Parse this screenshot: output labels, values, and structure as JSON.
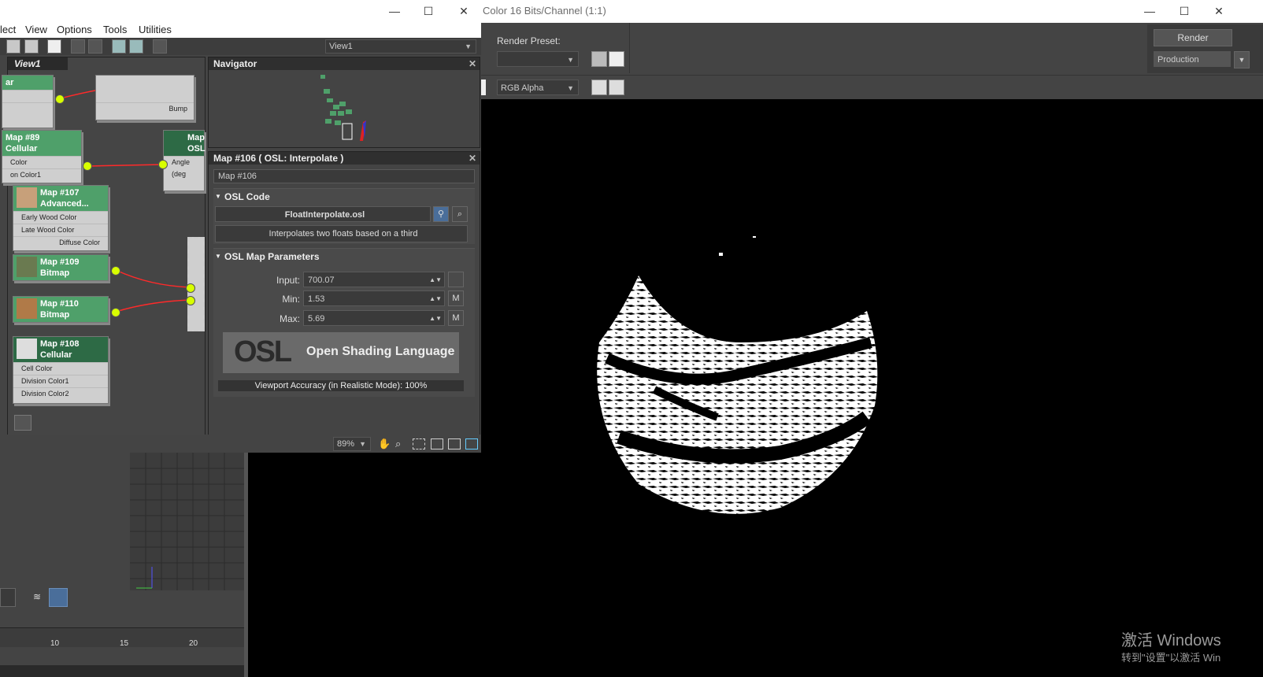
{
  "render_window": {
    "title": "Color 16 Bits/Channel (1:1)",
    "render_preset_label": "Render Preset:",
    "render_preset_value": "",
    "render_button": "Render",
    "production_value": "Production",
    "channel_value": "RGB Alpha"
  },
  "slate": {
    "menu": [
      "lect",
      "View",
      "Options",
      "Tools",
      "Utilities"
    ],
    "view_dropdown": "View1",
    "view_tab": "View1",
    "zoom": "89%"
  },
  "nodes": {
    "n_top_left": {
      "rows": [
        "",
        ""
      ],
      "header": "ar"
    },
    "n_top_right": {
      "rows": [
        "Bump"
      ]
    },
    "n89": {
      "title": "Map #89",
      "sub": "Cellular",
      "rows": [
        "Color",
        "on Color1"
      ]
    },
    "n_osl": {
      "title": "Map",
      "sub": "OSL",
      "rows": [
        "Angle (deg"
      ]
    },
    "n107": {
      "title": "Map #107",
      "sub": "Advanced...",
      "rows": [
        "Early Wood Color",
        "Late Wood Color",
        "Diffuse Color"
      ]
    },
    "n109": {
      "title": "Map #109",
      "sub": "Bitmap"
    },
    "n110": {
      "title": "Map #110",
      "sub": "Bitmap"
    },
    "n108": {
      "title": "Map #108",
      "sub": "Cellular",
      "rows": [
        "Cell Color",
        "Division Color1",
        "Division Color2"
      ]
    }
  },
  "navigator": {
    "title": "Navigator"
  },
  "params": {
    "title": "Map #106  ( OSL: Interpolate )",
    "name_field": "Map #106",
    "osl_code": {
      "heading": "OSL Code",
      "file": "FloatInterpolate.osl",
      "description": "Interpolates two floats based on a third"
    },
    "osl_map_params": {
      "heading": "OSL Map Parameters",
      "input_label": "Input:",
      "input_value": "700.07",
      "min_label": "Min:",
      "min_value": "1.53",
      "max_label": "Max:",
      "max_value": "5.69",
      "m_label": "M"
    },
    "logo_text": "Open Shading Language",
    "logo_mark": "OSL",
    "viewport_accuracy": "Viewport Accuracy (in Realistic Mode): 100%"
  },
  "timeline": {
    "ticks": [
      "10",
      "15",
      "20"
    ]
  },
  "watermark": {
    "line1": "激活 Windows",
    "line2": "转到\"设置\"以激活 Win"
  }
}
